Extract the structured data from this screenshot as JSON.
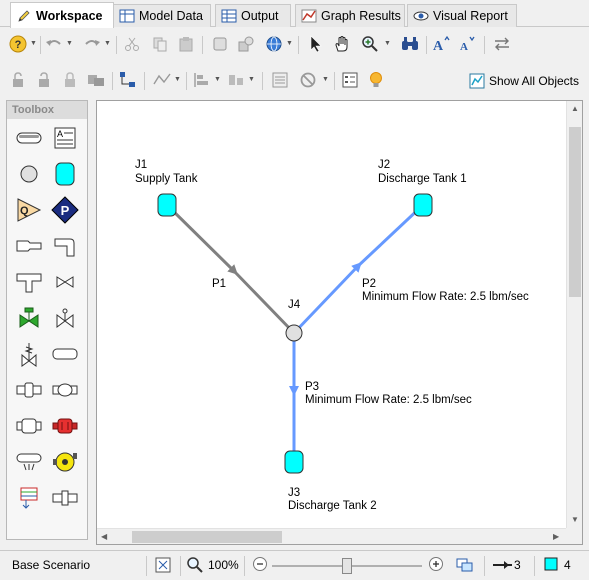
{
  "tabs": [
    {
      "label": "Workspace",
      "active": true
    },
    {
      "label": "Model Data",
      "active": false
    },
    {
      "label": "Output",
      "active": false
    },
    {
      "label": "Graph Results",
      "active": false
    },
    {
      "label": "Visual Report",
      "active": false
    }
  ],
  "toolbar": {
    "show_all_objects": "Show All Objects"
  },
  "toolbox": {
    "title": "Toolbox"
  },
  "workspace": {
    "junctions": [
      {
        "id": "J1",
        "name": "Supply Tank"
      },
      {
        "id": "J2",
        "name": "Discharge Tank 1"
      },
      {
        "id": "J3",
        "name": "Discharge Tank 2"
      },
      {
        "id": "J4",
        "name": ""
      }
    ],
    "pipes": [
      {
        "id": "P1",
        "detail": ""
      },
      {
        "id": "P2",
        "detail": "Minimum Flow Rate: 2.5 lbm/sec"
      },
      {
        "id": "P3",
        "detail": "Minimum Flow Rate: 2.5 lbm/sec"
      }
    ]
  },
  "status": {
    "scenario": "Base Scenario",
    "zoom": "100%",
    "zoom_slider_value": 0.5,
    "pipe_count": "3",
    "junction_count": "4"
  },
  "colors": {
    "tank_fill": "#00ffff",
    "selected_pipe": "#6699ff",
    "unselected_pipe": "#808080"
  }
}
